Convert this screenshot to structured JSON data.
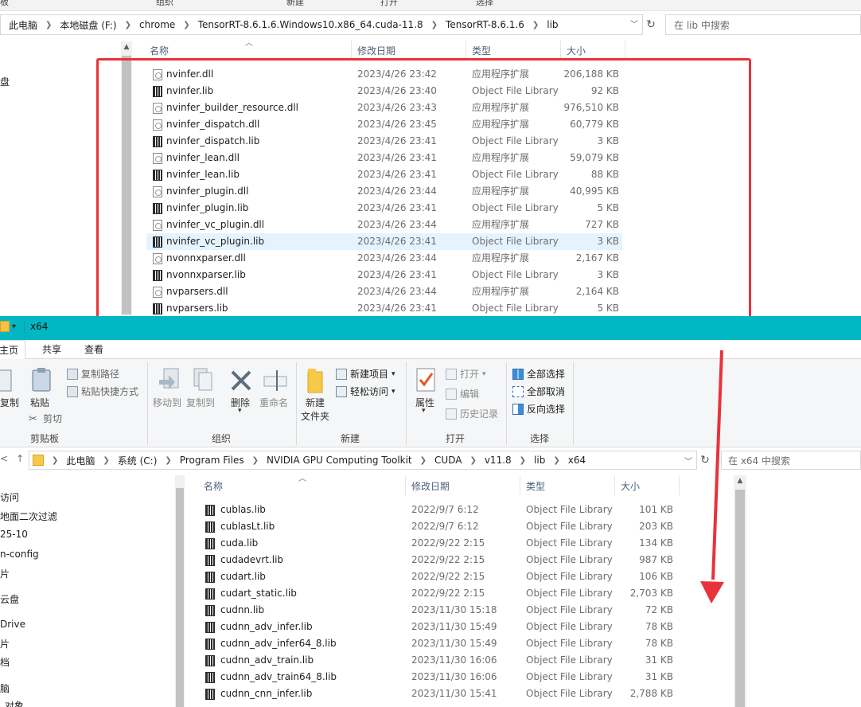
{
  "top_window": {
    "ribbon_fragments": [
      "板",
      "组织",
      "新建",
      "打开",
      "选择"
    ],
    "breadcrumb": [
      "此电脑",
      "本地磁盘 (F:)",
      "chrome",
      "TensorRT-8.6.1.6.Windows10.x86_64.cuda-11.8",
      "TensorRT-8.6.1.6",
      "lib"
    ],
    "search_placeholder": "在 lib 中搜索",
    "nav_fragment": "盘",
    "columns": {
      "name": "名称",
      "date": "修改日期",
      "type": "类型",
      "size": "大小"
    },
    "files": [
      {
        "name": "nvinfer.dll",
        "date": "2023/4/26 23:42",
        "type": "应用程序扩展",
        "size": "206,188 KB",
        "kind": "dll"
      },
      {
        "name": "nvinfer.lib",
        "date": "2023/4/26 23:40",
        "type": "Object File Library",
        "size": "92 KB",
        "kind": "lib"
      },
      {
        "name": "nvinfer_builder_resource.dll",
        "date": "2023/4/26 23:43",
        "type": "应用程序扩展",
        "size": "976,510 KB",
        "kind": "dll"
      },
      {
        "name": "nvinfer_dispatch.dll",
        "date": "2023/4/26 23:45",
        "type": "应用程序扩展",
        "size": "60,779 KB",
        "kind": "dll"
      },
      {
        "name": "nvinfer_dispatch.lib",
        "date": "2023/4/26 23:41",
        "type": "Object File Library",
        "size": "3 KB",
        "kind": "lib"
      },
      {
        "name": "nvinfer_lean.dll",
        "date": "2023/4/26 23:41",
        "type": "应用程序扩展",
        "size": "59,079 KB",
        "kind": "dll"
      },
      {
        "name": "nvinfer_lean.lib",
        "date": "2023/4/26 23:41",
        "type": "Object File Library",
        "size": "88 KB",
        "kind": "lib"
      },
      {
        "name": "nvinfer_plugin.dll",
        "date": "2023/4/26 23:44",
        "type": "应用程序扩展",
        "size": "40,995 KB",
        "kind": "dll"
      },
      {
        "name": "nvinfer_plugin.lib",
        "date": "2023/4/26 23:41",
        "type": "Object File Library",
        "size": "5 KB",
        "kind": "lib"
      },
      {
        "name": "nvinfer_vc_plugin.dll",
        "date": "2023/4/26 23:44",
        "type": "应用程序扩展",
        "size": "727 KB",
        "kind": "dll"
      },
      {
        "name": "nvinfer_vc_plugin.lib",
        "date": "2023/4/26 23:41",
        "type": "Object File Library",
        "size": "3 KB",
        "kind": "lib",
        "selected": true
      },
      {
        "name": "nvonnxparser.dll",
        "date": "2023/4/26 23:44",
        "type": "应用程序扩展",
        "size": "2,167 KB",
        "kind": "dll"
      },
      {
        "name": "nvonnxparser.lib",
        "date": "2023/4/26 23:41",
        "type": "Object File Library",
        "size": "3 KB",
        "kind": "lib"
      },
      {
        "name": "nvparsers.dll",
        "date": "2023/4/26 23:44",
        "type": "应用程序扩展",
        "size": "2,164 KB",
        "kind": "dll"
      },
      {
        "name": "nvparsers.lib",
        "date": "2023/4/26 23:41",
        "type": "Object File Library",
        "size": "5 KB",
        "kind": "lib"
      }
    ]
  },
  "bottom_window": {
    "title": "x64",
    "tabs": [
      "主页",
      "共享",
      "查看"
    ],
    "ribbon": {
      "clipboard": {
        "label": "剪贴板",
        "copy": "复制",
        "paste": "粘贴",
        "copy_path": "复制路径",
        "paste_shortcut": "粘贴快捷方式",
        "cut": "剪切"
      },
      "organize": {
        "label": "组织",
        "move_to": "移动到",
        "copy_to": "复制到",
        "delete": "删除",
        "rename": "重命名"
      },
      "new": {
        "label": "新建",
        "new_folder_1": "新建",
        "new_folder_2": "文件夹",
        "new_item": "新建项目",
        "easy_access": "轻松访问"
      },
      "open": {
        "label": "打开",
        "properties": "属性",
        "open": "打开",
        "edit": "编辑",
        "history": "历史记录"
      },
      "select": {
        "label": "选择",
        "select_all": "全部选择",
        "select_none": "全部取消",
        "invert": "反向选择"
      }
    },
    "breadcrumb": [
      "此电脑",
      "系统 (C:)",
      "Program Files",
      "NVIDIA GPU Computing Toolkit",
      "CUDA",
      "v11.8",
      "lib",
      "x64"
    ],
    "search_placeholder": "在 x64 中搜索",
    "nav_items": [
      "访问",
      "地面二次过滤",
      "25-10",
      "n-config",
      "片",
      "云盘",
      "Drive",
      "片",
      "档",
      "脑",
      "对象"
    ],
    "columns": {
      "name": "名称",
      "date": "修改日期",
      "type": "类型",
      "size": "大小"
    },
    "files": [
      {
        "name": "cublas.lib",
        "date": "2022/9/7 6:12",
        "type": "Object File Library",
        "size": "101 KB"
      },
      {
        "name": "cublasLt.lib",
        "date": "2022/9/7 6:12",
        "type": "Object File Library",
        "size": "203 KB"
      },
      {
        "name": "cuda.lib",
        "date": "2022/9/22 2:15",
        "type": "Object File Library",
        "size": "134 KB"
      },
      {
        "name": "cudadevrt.lib",
        "date": "2022/9/22 2:15",
        "type": "Object File Library",
        "size": "987 KB"
      },
      {
        "name": "cudart.lib",
        "date": "2022/9/22 2:15",
        "type": "Object File Library",
        "size": "106 KB"
      },
      {
        "name": "cudart_static.lib",
        "date": "2022/9/22 2:15",
        "type": "Object File Library",
        "size": "2,703 KB"
      },
      {
        "name": "cudnn.lib",
        "date": "2023/11/30 15:18",
        "type": "Object File Library",
        "size": "72 KB"
      },
      {
        "name": "cudnn_adv_infer.lib",
        "date": "2023/11/30 15:49",
        "type": "Object File Library",
        "size": "78 KB"
      },
      {
        "name": "cudnn_adv_infer64_8.lib",
        "date": "2023/11/30 15:49",
        "type": "Object File Library",
        "size": "78 KB"
      },
      {
        "name": "cudnn_adv_train.lib",
        "date": "2023/11/30 16:06",
        "type": "Object File Library",
        "size": "31 KB"
      },
      {
        "name": "cudnn_adv_train64_8.lib",
        "date": "2023/11/30 16:06",
        "type": "Object File Library",
        "size": "31 KB"
      },
      {
        "name": "cudnn_cnn_infer.lib",
        "date": "2023/11/30 15:41",
        "type": "Object File Library",
        "size": "2,788 KB"
      }
    ]
  },
  "colors": {
    "accent_titlebar": "#00b7c3",
    "annotation_red": "#e8333a",
    "selection": "#e5f3ff"
  }
}
